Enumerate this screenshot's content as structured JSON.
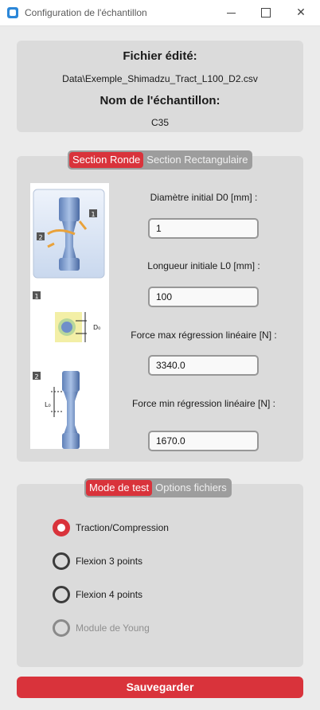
{
  "window": {
    "title": "Configuration de l'échantillon",
    "controls": {
      "minimize": "",
      "maximize": "",
      "close": "✕"
    }
  },
  "file_info": {
    "file_label": "Fichier édité:",
    "file_path": "Data\\Exemple_Shimadzu_Tract_L100_D2.csv",
    "sample_label": "Nom de l'échantillon:",
    "sample_name": "C35"
  },
  "section_tabs": [
    {
      "label": "Section Ronde",
      "active": true
    },
    {
      "label": "Section Rectangulaire",
      "active": false
    }
  ],
  "illustration": {
    "badge_1": "1",
    "badge_2": "2",
    "d0_label": "D₀",
    "l0_label": "L₀"
  },
  "fields": [
    {
      "label": "Diamètre initial D0 [mm] :",
      "value": "1"
    },
    {
      "label": "Longueur initiale L0 [mm] :",
      "value": "100"
    },
    {
      "label": "Force max régression linéaire [N] :",
      "value": "3340.0"
    },
    {
      "label": "Force min régression linéaire [N] :",
      "value": "1670.0"
    }
  ],
  "mode_tabs": [
    {
      "label": "Mode de test",
      "active": true
    },
    {
      "label": "Options fichiers",
      "active": false
    }
  ],
  "radios": [
    {
      "label": "Traction/Compression",
      "checked": true,
      "disabled": false
    },
    {
      "label": "Flexion 3 points",
      "checked": false,
      "disabled": false
    },
    {
      "label": "Flexion 4 points",
      "checked": false,
      "disabled": false
    },
    {
      "label": "Module de Young",
      "checked": false,
      "disabled": true
    }
  ],
  "save_label": "Sauvegarder",
  "colors": {
    "accent": "#d9333b",
    "panel": "#dbdbdb",
    "background": "#ebebeb"
  }
}
